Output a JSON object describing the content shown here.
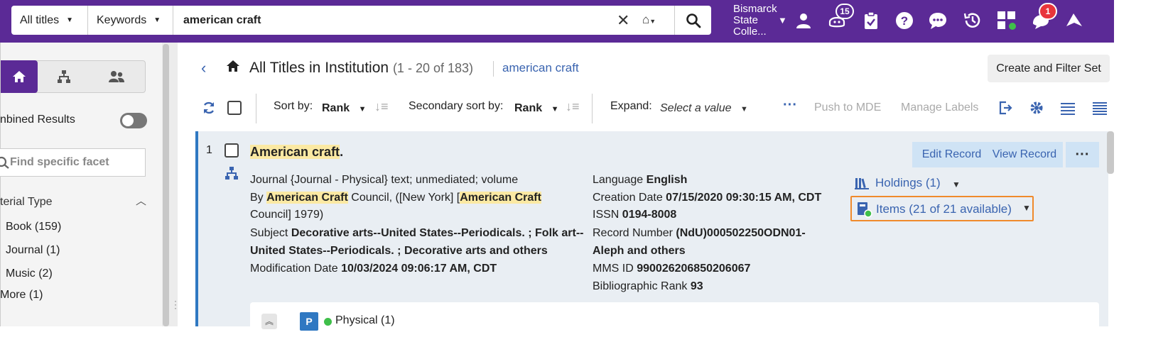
{
  "search": {
    "scope": "All titles",
    "field": "Keywords",
    "query": "american craft"
  },
  "header": {
    "institution": "Bismarck State Colle...",
    "tasks_count": "15",
    "notifications_count": "1"
  },
  "sidebar": {
    "combined_label": "nbined Results",
    "facet_search_placeholder": "Find specific facet",
    "facet_heading": "terial Type",
    "facets": [
      {
        "label": "Book (159)"
      },
      {
        "label": "Journal (1)"
      },
      {
        "label": "Music (2)"
      }
    ],
    "more_label": "More (1)"
  },
  "page": {
    "title": "All Titles in Institution",
    "range": "(1 - 20 of 183)",
    "query_link": "american craft",
    "create_filter_set": "Create and Filter Set"
  },
  "toolbar": {
    "sort_label": "Sort by:",
    "sort_value": "Rank",
    "secondary_label": "Secondary sort by:",
    "secondary_value": "Rank",
    "expand_label": "Expand:",
    "expand_value": "Select a value",
    "push_to_mde": "Push to MDE",
    "manage_labels": "Manage Labels"
  },
  "record": {
    "number": "1",
    "title_highlight": "American craft",
    "title_rest": ".",
    "type_line": "Journal {Journal - Physical} text; unmediated; volume",
    "by_prefix": "By ",
    "by_hl1": "American Craft",
    "by_mid": " Council, ([New York] [",
    "by_hl2": "American Craft",
    "by_line2": "Council] 1979)",
    "subject_label": "Subject ",
    "subject_value1": "Decorative arts--United States--Periodicals. ; Folk art--",
    "subject_value2": "United States--Periodicals. ; Decorative arts and others",
    "mod_label": "Modification Date ",
    "mod_value": "10/03/2024 09:06:17 AM, CDT",
    "lang_label": "Language ",
    "lang_value": "English",
    "created_label": "Creation Date ",
    "created_value": "07/15/2020 09:30:15 AM, CDT",
    "issn_label": "ISSN ",
    "issn_value": "0194-8008",
    "recno_label": "Record Number ",
    "recno_value1": "(NdU)000502250ODN01-",
    "recno_value2": "Aleph and others",
    "mms_label": "MMS ID ",
    "mms_value": "990026206850206067",
    "rank_label": "Bibliographic Rank ",
    "rank_value": "93",
    "edit_record": "Edit Record",
    "view_record": "View Record",
    "holdings": "Holdings (1)",
    "items": "Items (21 of 21 available)",
    "physical_badge": "P",
    "physical_label": "Physical (1)"
  },
  "colors": {
    "brand": "#5b2a96",
    "link": "#3a64b0",
    "record_border": "#2f78c2",
    "highlight": "#fbe9a3",
    "focus_outline": "#f08a2b"
  }
}
